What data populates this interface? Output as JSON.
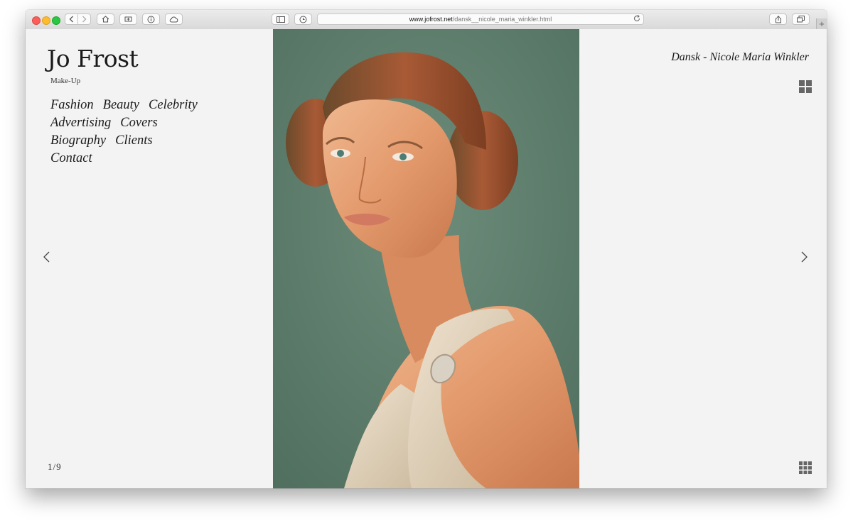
{
  "browser": {
    "url_host": "www.jofrost.net",
    "url_path": "/dansk__nicole_maria_winkler.html"
  },
  "site": {
    "brand": "Jo Frost",
    "tagline": "Make-Up"
  },
  "nav": {
    "rows": [
      [
        "Fashion",
        "Beauty",
        "Celebrity"
      ],
      [
        "Advertising",
        "Covers"
      ],
      [
        "Biography",
        "Clients"
      ],
      [
        "Contact"
      ]
    ]
  },
  "gallery": {
    "title": "Dansk - Nicole Maria Winkler",
    "counter": "1/9"
  },
  "colors": {
    "photo_background": "#5f7f6d",
    "page_background": "#f3f3f3",
    "text": "#1a1a1a"
  },
  "icons": {
    "prev": "chevron-left-icon",
    "next": "chevron-right-icon",
    "grid_large": "grid-2x2-icon",
    "grid_small": "grid-3x3-icon"
  }
}
